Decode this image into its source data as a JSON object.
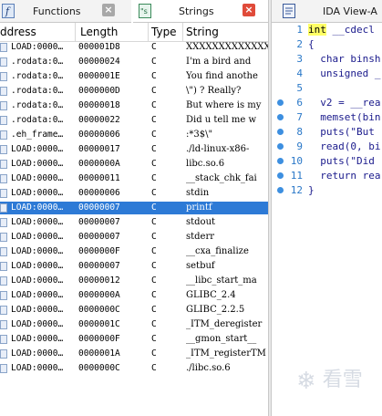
{
  "tabs": {
    "functions": {
      "label": "Functions",
      "icon": "function-icon",
      "close": "×"
    },
    "strings": {
      "label": "Strings",
      "icon": "strings-icon",
      "close": "×"
    },
    "ida_view": {
      "label": "IDA View-A",
      "icon": "document-icon"
    }
  },
  "columns": [
    "ddress",
    "Length",
    "Type",
    "String"
  ],
  "rows": [
    {
      "addr": "LOAD:0000…",
      "len": "000001D8",
      "type": "C",
      "str": "XXXXXXXXXXXXXXXX"
    },
    {
      "addr": ".rodata:0…",
      "len": "00000024",
      "type": "C",
      "str": "I'm a bird and"
    },
    {
      "addr": ".rodata:0…",
      "len": "0000001E",
      "type": "C",
      "str": "You find anothe"
    },
    {
      "addr": ".rodata:0…",
      "len": "0000000D",
      "type": "C",
      "str": "\\\") ? Really?"
    },
    {
      "addr": ".rodata:0…",
      "len": "00000018",
      "type": "C",
      "str": "But where is my"
    },
    {
      "addr": ".rodata:0…",
      "len": "00000022",
      "type": "C",
      "str": "Did u tell me w"
    },
    {
      "addr": ".eh_frame…",
      "len": "00000006",
      "type": "C",
      "str": ":*3$\\\""
    },
    {
      "addr": "LOAD:0000…",
      "len": "00000017",
      "type": "C",
      "str": "./ld-linux-x86-"
    },
    {
      "addr": "LOAD:0000…",
      "len": "0000000A",
      "type": "C",
      "str": "libc.so.6"
    },
    {
      "addr": "LOAD:0000…",
      "len": "00000011",
      "type": "C",
      "str": "__stack_chk_fai"
    },
    {
      "addr": "LOAD:0000…",
      "len": "00000006",
      "type": "C",
      "str": "stdin"
    },
    {
      "addr": "LOAD:0000…",
      "len": "00000007",
      "type": "C",
      "str": "printf",
      "selected": true
    },
    {
      "addr": "LOAD:0000…",
      "len": "00000007",
      "type": "C",
      "str": "stdout"
    },
    {
      "addr": "LOAD:0000…",
      "len": "00000007",
      "type": "C",
      "str": "stderr"
    },
    {
      "addr": "LOAD:0000…",
      "len": "0000000F",
      "type": "C",
      "str": "__cxa_finalize"
    },
    {
      "addr": "LOAD:0000…",
      "len": "00000007",
      "type": "C",
      "str": "setbuf"
    },
    {
      "addr": "LOAD:0000…",
      "len": "00000012",
      "type": "C",
      "str": "__libc_start_ma"
    },
    {
      "addr": "LOAD:0000…",
      "len": "0000000A",
      "type": "C",
      "str": "GLIBC_2.4"
    },
    {
      "addr": "LOAD:0000…",
      "len": "0000000C",
      "type": "C",
      "str": "GLIBC_2.2.5"
    },
    {
      "addr": "LOAD:0000…",
      "len": "0000001C",
      "type": "C",
      "str": "_ITM_deregister"
    },
    {
      "addr": "LOAD:0000…",
      "len": "0000000F",
      "type": "C",
      "str": "__gmon_start__"
    },
    {
      "addr": "LOAD:0000…",
      "len": "0000001A",
      "type": "C",
      "str": "_ITM_registerTM"
    },
    {
      "addr": "LOAD:0000…",
      "len": "0000000C",
      "type": "C",
      "str": "./libc.so.6"
    }
  ],
  "code_lines": [
    {
      "n": "1",
      "text": " __cdecl",
      "kw": "int",
      "bp": false
    },
    {
      "n": "2",
      "text": "{",
      "bp": false
    },
    {
      "n": "3",
      "text": "  char binsh",
      "bp": false
    },
    {
      "n": "4",
      "text": "  unsigned _",
      "bp": false
    },
    {
      "n": "5",
      "text": "",
      "bp": false
    },
    {
      "n": "6",
      "text": "  v2 = __rea",
      "bp": true
    },
    {
      "n": "7",
      "text": "  memset(bin",
      "bp": true
    },
    {
      "n": "8",
      "text": "  puts(\"But",
      "bp": true
    },
    {
      "n": "9",
      "text": "  read(0, bi",
      "bp": true
    },
    {
      "n": "10",
      "text": "  puts(\"Did",
      "bp": true
    },
    {
      "n": "11",
      "text": "  return rea",
      "bp": true
    },
    {
      "n": "12",
      "text": "}",
      "bp": true
    }
  ],
  "watermark": {
    "icon": "snowflake-icon",
    "text": "看雪"
  },
  "colors": {
    "selection": "#2d7ad6",
    "breakpoint": "#3d8fe0",
    "close_red": "#e04b3a",
    "close_gray": "#a8a8a8"
  }
}
